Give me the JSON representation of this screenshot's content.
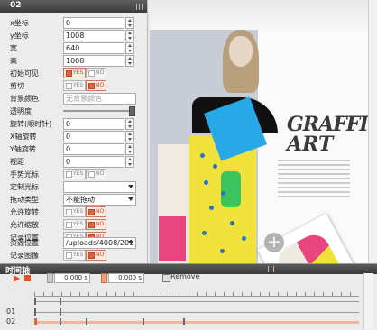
{
  "panel": {
    "title": "02",
    "rows": [
      {
        "label": "x坐标",
        "value": "0"
      },
      {
        "label": "y坐标",
        "value": "1008"
      },
      {
        "label": "宽",
        "value": "640"
      },
      {
        "label": "高",
        "value": "1008"
      },
      {
        "label": "初始可见",
        "yes": "YES",
        "no": "NO",
        "selected": "yes"
      },
      {
        "label": "剪切",
        "yes": "YES",
        "no": "NO",
        "selected": "no"
      },
      {
        "label": "背景颜色",
        "placeholder": "无背景颜色"
      },
      {
        "label": "透明度",
        "level": 1.0
      },
      {
        "label": "旋转(顺时针)",
        "value": "0"
      },
      {
        "label": "X轴旋转",
        "value": "0"
      },
      {
        "label": "Y轴旋转",
        "value": "0"
      },
      {
        "label": "视距",
        "value": "0"
      },
      {
        "label": "手势光标",
        "yes": "YES",
        "no": "NO",
        "selected": "none"
      },
      {
        "label": "定制光标",
        "value": ""
      },
      {
        "label": "拖动类型",
        "value": "不能拖动"
      },
      {
        "label": "允许旋转",
        "yes": "YES",
        "no": "NO",
        "selected": "no"
      },
      {
        "label": "允许缩放",
        "yes": "YES",
        "no": "NO",
        "selected": "no"
      },
      {
        "label": "记录位置",
        "yes": "YES",
        "no": "NO",
        "selected": "no"
      },
      {
        "label": "资源位置",
        "value": "/uploads/4008/201"
      },
      {
        "label": "记录图像",
        "yes": "YES",
        "no": "NO",
        "selected": "no"
      }
    ]
  },
  "canvas": {
    "headline_1": "GRAFFITI",
    "headline_2": "ART",
    "add_button": "+"
  },
  "timeline": {
    "title": "时间轴",
    "time_start": "0.000 s",
    "time_end": "0.000 s",
    "remove_label": "Remove",
    "tracks": [
      {
        "label": ""
      },
      {
        "label": "01"
      },
      {
        "label": "02"
      }
    ]
  },
  "colors": {
    "accent": "#e3522a",
    "header": "#3a3a3a",
    "panel_bg": "#ececec"
  }
}
